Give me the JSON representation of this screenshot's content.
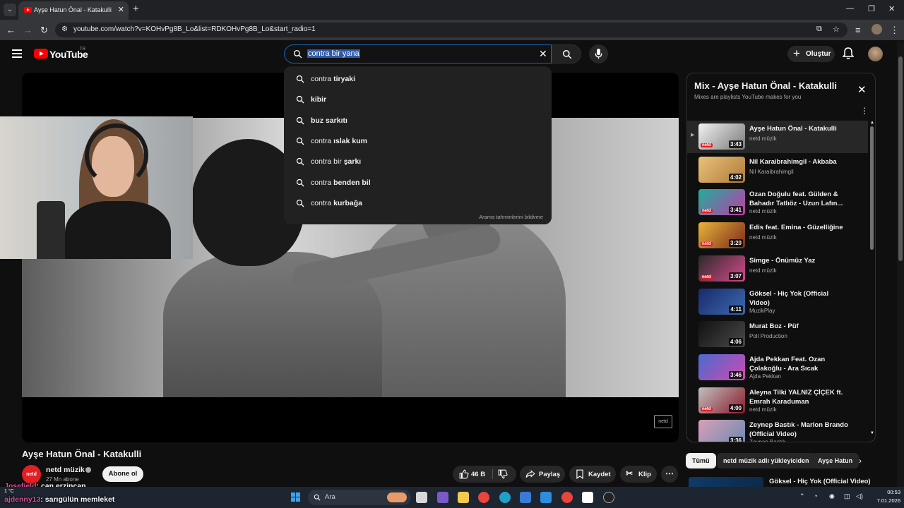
{
  "browser": {
    "tab_title": "Ayşe Hatun Önal - Katakulli - YouTube",
    "url": "youtube.com/watch?v=KOHvPg8B_Lo&list=RDKOHvPg8B_Lo&start_radio=1"
  },
  "header": {
    "logo_text": "YouTube",
    "region": "TR",
    "search_value": "contra bir yana",
    "create_label": "Oluştur"
  },
  "suggestions": {
    "items": [
      {
        "prefix": "contra ",
        "bold": "tiryaki"
      },
      {
        "prefix": "",
        "bold": "kibir"
      },
      {
        "prefix": "",
        "bold": "buz sarkıtı"
      },
      {
        "prefix": "contra ",
        "bold": "ıslak kum"
      },
      {
        "prefix": "contra bir ",
        "bold": "şarkı"
      },
      {
        "prefix": "contra ",
        "bold": "benden bil"
      },
      {
        "prefix": "contra ",
        "bold": "kurbağa"
      }
    ],
    "footer": "Arama tahminlerini bildirme"
  },
  "player": {
    "watermark": "netd"
  },
  "video": {
    "title": "Ayşe Hatun Önal - Katakulli",
    "channel": "netd müzik",
    "channel_avatar_text": "netd",
    "subscribers": "27 Mn abone",
    "subscribe_label": "Abone ol",
    "likes": "46 B",
    "share_label": "Paylaş",
    "save_label": "Kaydet",
    "clip_label": "Klip"
  },
  "mix": {
    "title": "Mix - Ayşe Hatun Önal - Katakulli",
    "subtitle": "Mixes are playlists YouTube makes for you",
    "items": [
      {
        "title": "Ayşe Hatun Önal - Katakulli",
        "channel": "netd müzik",
        "duration": "3:43",
        "logo": "netd",
        "colors": [
          "#f2f2f2",
          "#7a7a7a"
        ]
      },
      {
        "title": "Nil Karaibrahimgil - Akbaba",
        "channel": "Nil Karaibrahimgil",
        "duration": "4:02",
        "logo": "",
        "colors": [
          "#e9c27a",
          "#b07a3a"
        ]
      },
      {
        "title": "Ozan Doğulu feat. Gülden & Bahadır Tatlıöz - Uzun Lafın...",
        "channel": "netd müzik",
        "duration": "3:41",
        "logo": "netd",
        "colors": [
          "#1fae9a",
          "#c03aa8"
        ]
      },
      {
        "title": "Edis feat. Emina - Güzelliğine",
        "channel": "netd müzik",
        "duration": "3:20",
        "logo": "netd",
        "colors": [
          "#e9b43a",
          "#7a2a1a"
        ]
      },
      {
        "title": "Simge - Önümüz Yaz",
        "channel": "netd müzik",
        "duration": "3:07",
        "logo": "netd",
        "colors": [
          "#2a2a2a",
          "#d64a8a"
        ]
      },
      {
        "title": "Göksel - Hiç Yok (Official Video)",
        "channel": "MuzikPlay",
        "duration": "4:11",
        "logo": "",
        "colors": [
          "#1a2a6a",
          "#3a6ab0"
        ]
      },
      {
        "title": "Murat Boz - Püf",
        "channel": "Poll Production",
        "duration": "4:06",
        "logo": "",
        "colors": [
          "#111111",
          "#4a4a4a"
        ]
      },
      {
        "title": "Ajda Pekkan Feat. Ozan Çolakoğlu - Ara Sıcak (Officia...",
        "channel": "Ajda Pekkan",
        "duration": "3:46",
        "logo": "",
        "colors": [
          "#4a6ad0",
          "#d04ab0"
        ]
      },
      {
        "title": "Aleyna Tilki YALNIZ ÇİÇEK ft. Emrah Karaduman",
        "channel": "netd müzik",
        "duration": "4:00",
        "logo": "netd",
        "colors": [
          "#c0c0c0",
          "#8a1a2a"
        ]
      },
      {
        "title": "Zeynep Bastık - Marlon Brando (Official Video)",
        "channel": "Zeynep Bastık",
        "duration": "3:36",
        "logo": "",
        "colors": [
          "#d8a0b8",
          "#6a8ab0"
        ]
      }
    ]
  },
  "chips": [
    "Tümü",
    "netd müzik adlı yükleyiciden",
    "Ayşe Hatun"
  ],
  "next_rec_title": "Göksel - Hiç Yok (Official Video)",
  "chat": [
    {
      "user": "Josefield",
      "text": ": can erzincan"
    },
    {
      "user": "ajdenny13",
      "text": ": sarıgülün memleket"
    }
  ],
  "taskbar": {
    "weather": "1 °C",
    "search_label": "Ara",
    "time": "00:53",
    "date": "7.01.2026"
  }
}
